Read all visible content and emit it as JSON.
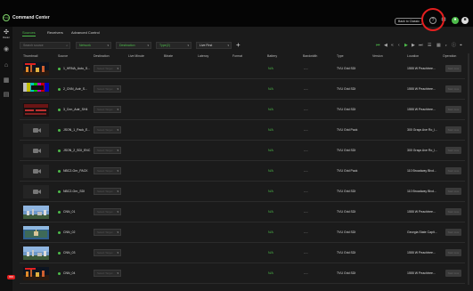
{
  "app": {
    "title": "Command Center",
    "logo": "TVU"
  },
  "topbar": {
    "back_to_classic": "Back to Classic",
    "icons": [
      "help-icon",
      "settings-icon",
      "user-icon",
      "notification-icon"
    ]
  },
  "sidebar": {
    "items": [
      {
        "icon": "router-icon",
        "label": "Router"
      },
      {
        "icon": "camera-icon",
        "label": ""
      },
      {
        "icon": "home-icon",
        "label": ""
      },
      {
        "icon": "grid-icon",
        "label": ""
      },
      {
        "icon": "list-icon",
        "label": ""
      }
    ],
    "badge": "999"
  },
  "tabs": [
    {
      "label": "Sources",
      "active": true
    },
    {
      "label": "Receivers",
      "active": false
    },
    {
      "label": "Advanced Control",
      "active": false
    }
  ],
  "filters": {
    "search_placeholder": "Search source",
    "network": "Network",
    "destination": "Destination",
    "type": "Type(2)",
    "live_first": "Live First"
  },
  "table": {
    "columns": [
      "Thumbnail",
      "Source",
      "Destination",
      "Live Minute",
      "Bitrate",
      "Latency",
      "Format",
      "Battery",
      "Bandwidth",
      "Type",
      "Version",
      "Location",
      "Operation"
    ],
    "rows": [
      {
        "thumb": "dark-city",
        "source": "1_HRNA_Autu_S...",
        "destination": "Select Target",
        "battery": "N/A",
        "bandwidth": "----",
        "type": "TVU Grid SDI",
        "location": "1555 W Peachtree...",
        "operation": "Start Live"
      },
      {
        "thumb": "test-pattern",
        "source": "2_CNN_Autr_S...",
        "destination": "Select Target",
        "battery": "N/A",
        "bandwidth": "----",
        "type": "TVU Grid SDI",
        "location": "1555 W Peachtree...",
        "operation": "Start Live"
      },
      {
        "thumb": "slate-red",
        "source": "3_Cnn_Autr_SH4",
        "destination": "Select Target",
        "battery": "N/A",
        "bandwidth": "----",
        "type": "TVU Grid SDI",
        "location": "1555 W Peachtree...",
        "operation": "Start Live"
      },
      {
        "thumb": "camera",
        "source": "JSON_1_Pack_E...",
        "destination": "Select Target",
        "battery": "N/A",
        "bandwidth": "----",
        "type": "TVU Grid Pack",
        "location": "300 Grays Ave Ro_l...",
        "operation": "Start Live"
      },
      {
        "thumb": "camera",
        "source": "JSON_2_SDI_ENC",
        "destination": "Select Target",
        "battery": "N/A",
        "bandwidth": "----",
        "type": "TVU Grid SDI",
        "location": "300 Grays Ave Ro_l...",
        "operation": "Start Live"
      },
      {
        "thumb": "camera",
        "source": "NBC2-Grn_PACK",
        "destination": "Select Target",
        "battery": "N/A",
        "bandwidth": "----",
        "type": "TVU Grid Pack",
        "location": "110 Broadway Blvd...",
        "operation": "Start Live"
      },
      {
        "thumb": "camera",
        "source": "NBC2-Grn_SDI",
        "destination": "Select Target",
        "battery": "N/A",
        "bandwidth": "----",
        "type": "TVU Grid SDI",
        "location": "110 Broadway Blvd...",
        "operation": "Start Live"
      },
      {
        "thumb": "sky-city",
        "source": "CNN_01",
        "destination": "Select Target",
        "battery": "N/A",
        "bandwidth": "----",
        "type": "TVU Grid SDI",
        "location": "1555 W Peachtree...",
        "operation": "Start Live"
      },
      {
        "thumb": "aerial-city",
        "source": "CNN_02",
        "destination": "Select Target",
        "battery": "N/A",
        "bandwidth": "----",
        "type": "TVU Grid SDI",
        "location": "Georgia State Capit...",
        "operation": "Start Live"
      },
      {
        "thumb": "sky-city",
        "source": "CNN_03",
        "destination": "Select Target",
        "battery": "N/A",
        "bandwidth": "----",
        "type": "TVU Grid SDI",
        "location": "1555 W Peachtree...",
        "operation": "Start Live"
      },
      {
        "thumb": "dark-city",
        "source": "CNN_04",
        "destination": "Select Target",
        "battery": "N/A",
        "bandwidth": "----",
        "type": "TVU Grid SDI",
        "location": "1555 W Peachtree...",
        "operation": "Start Live"
      }
    ]
  },
  "colors": {
    "accent": "#4dbb4a",
    "highlight_ring": "#e41f1f"
  }
}
